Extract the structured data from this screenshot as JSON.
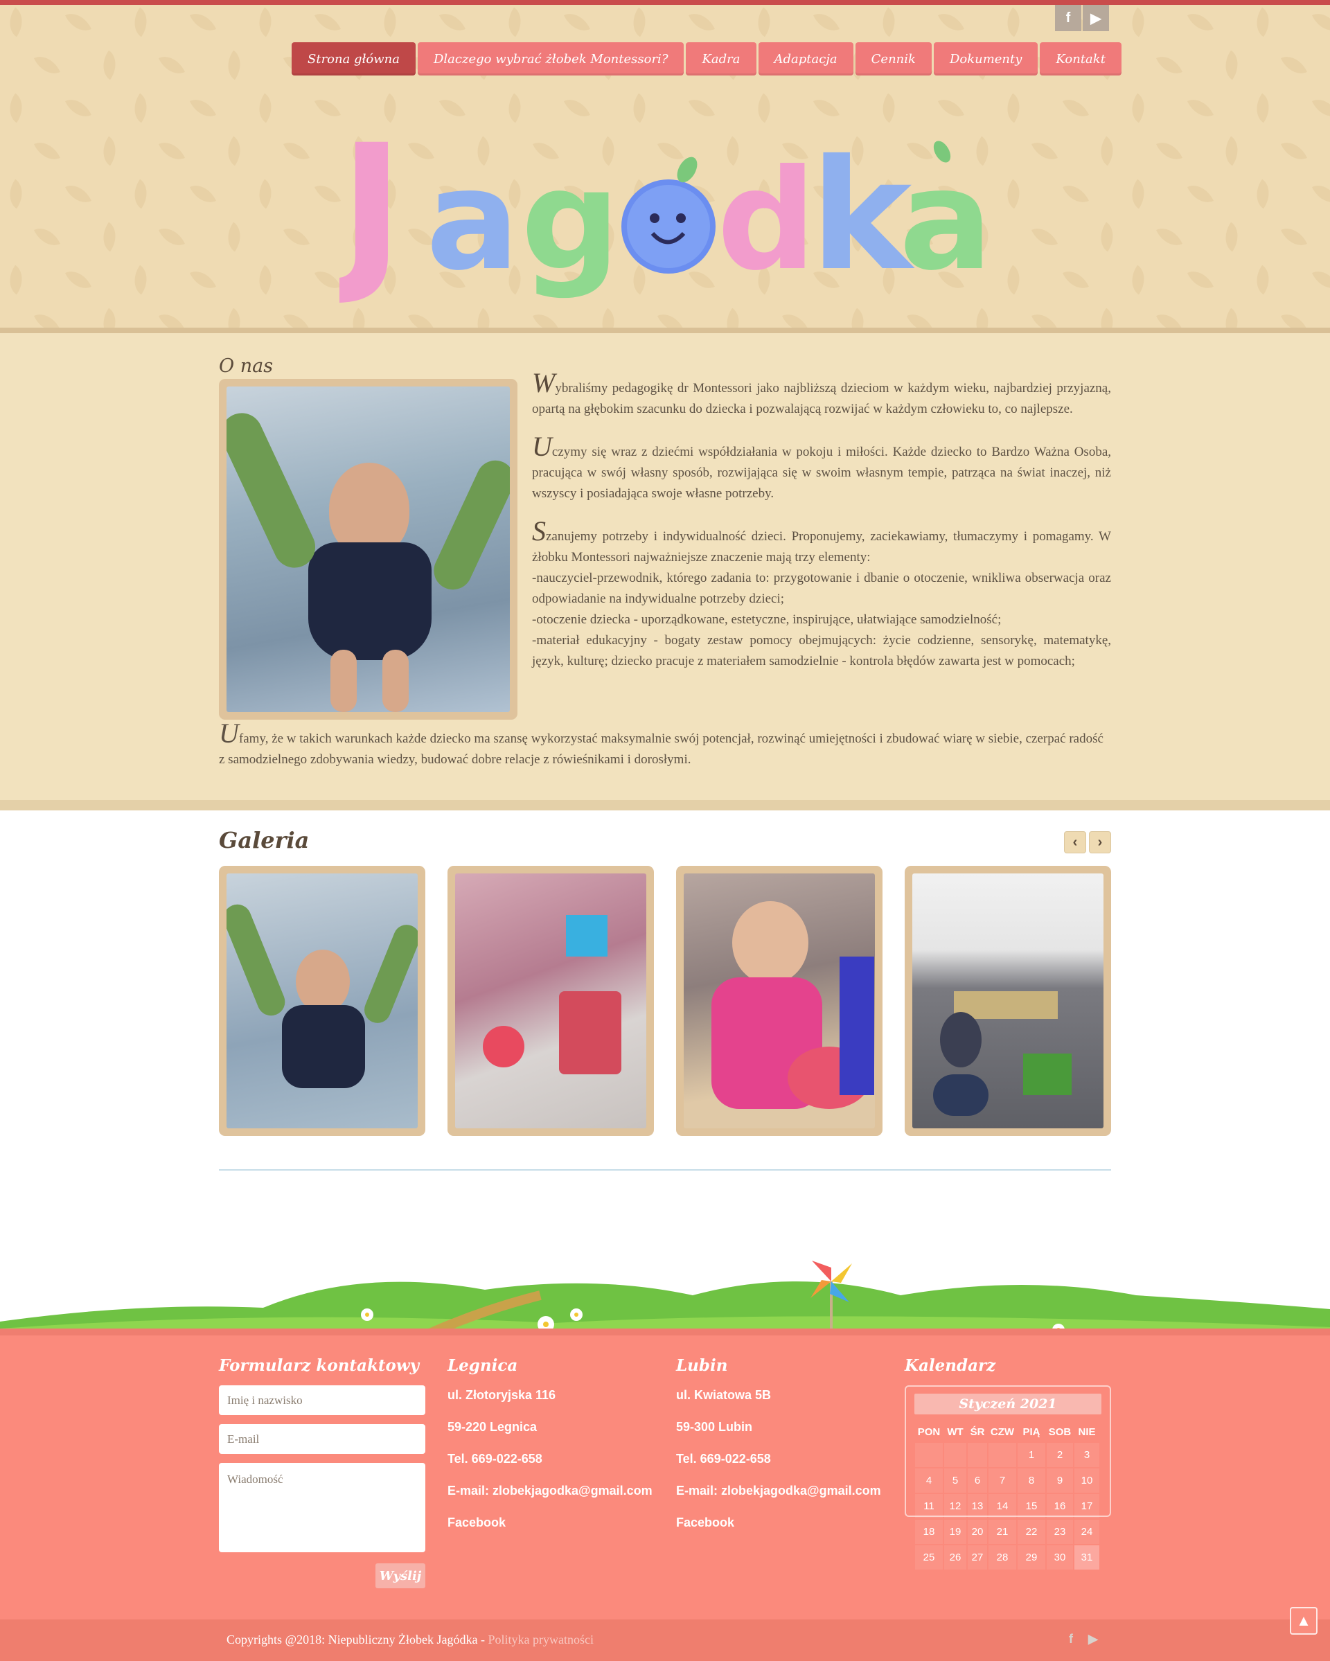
{
  "social_top": {
    "facebook": "f",
    "youtube": "▶"
  },
  "nav": {
    "items": [
      "Strona główna",
      "Dlaczego wybrać żłobek Montessori?",
      "Kadra",
      "Adaptacja",
      "Cennik",
      "Dokumenty",
      "Kontakt"
    ]
  },
  "logo": {
    "text": "Jagodka"
  },
  "about": {
    "title": "O nas",
    "p1_drop": "W",
    "p1": "ybraliśmy pedagogikę dr Montessori jako najbliższą dzieciom w każdym wieku, najbardziej przyjazną, opartą na głębokim szacunku do dziecka i pozwalającą rozwijać w każdym człowieku to, co najlepsze.",
    "p2_drop": "U",
    "p2": "czymy się wraz z dziećmi współdziałania w pokoju i miłości. Każde dziecko to Bardzo Ważna Osoba, pracująca w swój własny sposób, rozwijająca się w swoim własnym tempie, patrząca na świat inaczej, niż wszyscy i posiadająca swoje własne potrzeby.",
    "p3_drop": "S",
    "p3": "zanujemy potrzeby i indywidualność dzieci. Proponujemy, zaciekawiamy, tłumaczymy i pomagamy. W żłobku Montessori najważniejsze znaczenie mają trzy elementy:",
    "p3_l1": "-nauczyciel-przewodnik, którego zadania to: przygotowanie i dbanie o otoczenie, wnikliwa obserwacja oraz odpowiadanie na indywidualne potrzeby dzieci;",
    "p3_l2": "-otoczenie dziecka - uporządkowane, estetyczne, inspirujące, ułatwiające samodzielność;",
    "p3_l3": "-materiał edukacyjny - bogaty zestaw pomocy obejmujących: życie codzienne, sensorykę, matematykę, język, kulturę; dziecko pracuje z materiałem samodzielnie - kontrola błędów zawarta jest w pomocach;",
    "p4_drop": "U",
    "p4": "famy, że w takich warunkach każde dziecko ma szansę wykorzystać maksymalnie swój potencjał, rozwinąć umiejętności i zbudować wiarę w siebie, czerpać radość z samodzielnego zdobywania wiedzy, budować dobre relacje z rówieśnikami i dorosłymi."
  },
  "gallery": {
    "title": "Galeria",
    "prev": "‹",
    "next": "›"
  },
  "contact_form": {
    "title": "Formularz kontaktowy",
    "name_placeholder": "Imię i nazwisko",
    "email_placeholder": "E-mail",
    "message_placeholder": "Wiadomość",
    "send_label": "Wyślij"
  },
  "legnica": {
    "title": "Legnica",
    "street": "ul. Złotoryjska 116",
    "city": "59-220 Legnica",
    "phone": "Tel. 669-022-658",
    "email": "E-mail: zlobekjagodka@gmail.com",
    "facebook": "Facebook"
  },
  "lubin": {
    "title": "Lubin",
    "street": "ul. Kwiatowa 5B",
    "city": "59-300 Lubin",
    "phone": "Tel. 669-022-658",
    "email": "E-mail: zlobekjagodka@gmail.com",
    "facebook": "Facebook"
  },
  "calendar": {
    "title": "Kalendarz",
    "month": "Styczeń 2021",
    "weekdays": [
      "PON",
      "WT",
      "ŚR",
      "CZW",
      "PIĄ",
      "SOB",
      "NIE"
    ],
    "days": [
      "",
      "",
      "",
      "",
      "1",
      "2",
      "3",
      "4",
      "5",
      "6",
      "7",
      "8",
      "9",
      "10",
      "11",
      "12",
      "13",
      "14",
      "15",
      "16",
      "17",
      "18",
      "19",
      "20",
      "21",
      "22",
      "23",
      "24",
      "25",
      "26",
      "27",
      "28",
      "29",
      "30",
      "31"
    ],
    "today": "31"
  },
  "footer": {
    "copyright": "Copyrights @2018: Niepubliczny Żłobek Jagódka - ",
    "privacy": "Polityka prywatności",
    "facebook": "f",
    "youtube": "▶"
  },
  "colors": {
    "accent": "#f07a7a",
    "active": "#bf4848",
    "footer": "#fb8a7c",
    "cream": "#efdbb3"
  }
}
